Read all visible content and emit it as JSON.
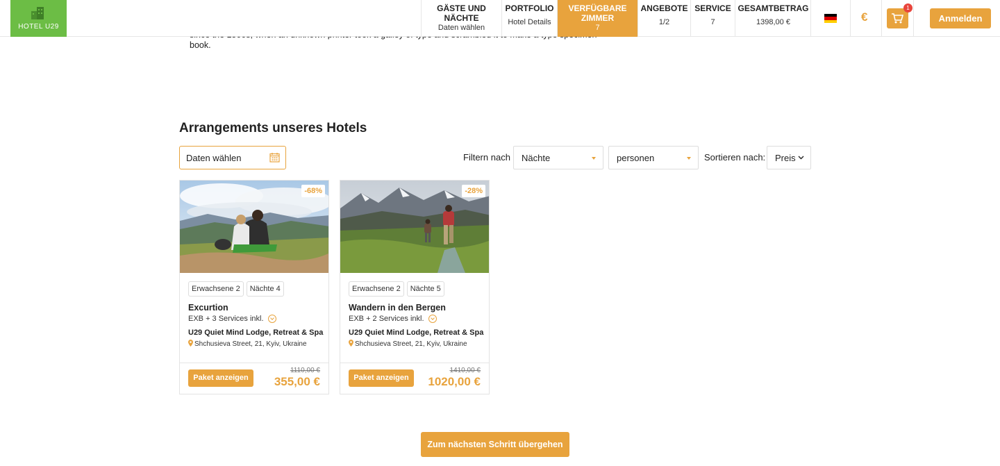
{
  "header": {
    "logo_text": "HOTEL U29",
    "steps": [
      {
        "title": "GÄSTE UND NÄCHTE",
        "sub": "Daten wählen"
      },
      {
        "title": "PORTFOLIO",
        "sub": "Hotel Details"
      },
      {
        "title": "VERFÜGBARE ZIMMER",
        "sub": "7"
      },
      {
        "title": "ANGEBOTE",
        "sub": "1/2"
      },
      {
        "title": "SERVICE",
        "sub": "7"
      },
      {
        "title": "GESAMTBETRAG",
        "sub": "1398,00 €"
      }
    ],
    "language_flag": "german-flag",
    "currency_symbol": "€",
    "cart_count": "1",
    "login_label": "Anmelden"
  },
  "intro": {
    "bullet": "•",
    "text": "since the 1500s, when an unknown printer took a galley of type and scrambled it to make a type specimen book."
  },
  "section": {
    "title": "Arrangements unseres Hotels",
    "date_placeholder": "Daten wählen",
    "filter_label": "Filtern nach",
    "nights_select": "Nächte",
    "persons_select": "personen",
    "sort_label": "Sortieren nach:",
    "sort_select": "Preis"
  },
  "cards": [
    {
      "discount": "-68%",
      "tags": [
        "Erwachsene 2",
        "Nächte 4"
      ],
      "title": "Excurtion",
      "services": "EXB + 3 Services inkl.",
      "hotel": "U29 Quiet Mind Lodge, Retreat & Spa",
      "address": "Shchusieva Street, 21, Kyiv, Ukraine",
      "button": "Paket anzeigen",
      "old_price": "1110,00 €",
      "new_price": "355,00 €"
    },
    {
      "discount": "-28%",
      "tags": [
        "Erwachsene 2",
        "Nächte 5"
      ],
      "title": "Wandern in den Bergen",
      "services": "EXB + 2 Services inkl.",
      "hotel": "U29 Quiet Mind Lodge, Retreat & Spa",
      "address": "Shchusieva Street, 21, Kyiv, Ukraine",
      "button": "Paket anzeigen",
      "old_price": "1410,00 €",
      "new_price": "1020,00 €"
    }
  ],
  "next_button": "Zum nächsten Schritt übergehen",
  "colors": {
    "accent": "#e8a33d",
    "logo_green": "#6cbd45",
    "badge_red": "#e8453c"
  }
}
